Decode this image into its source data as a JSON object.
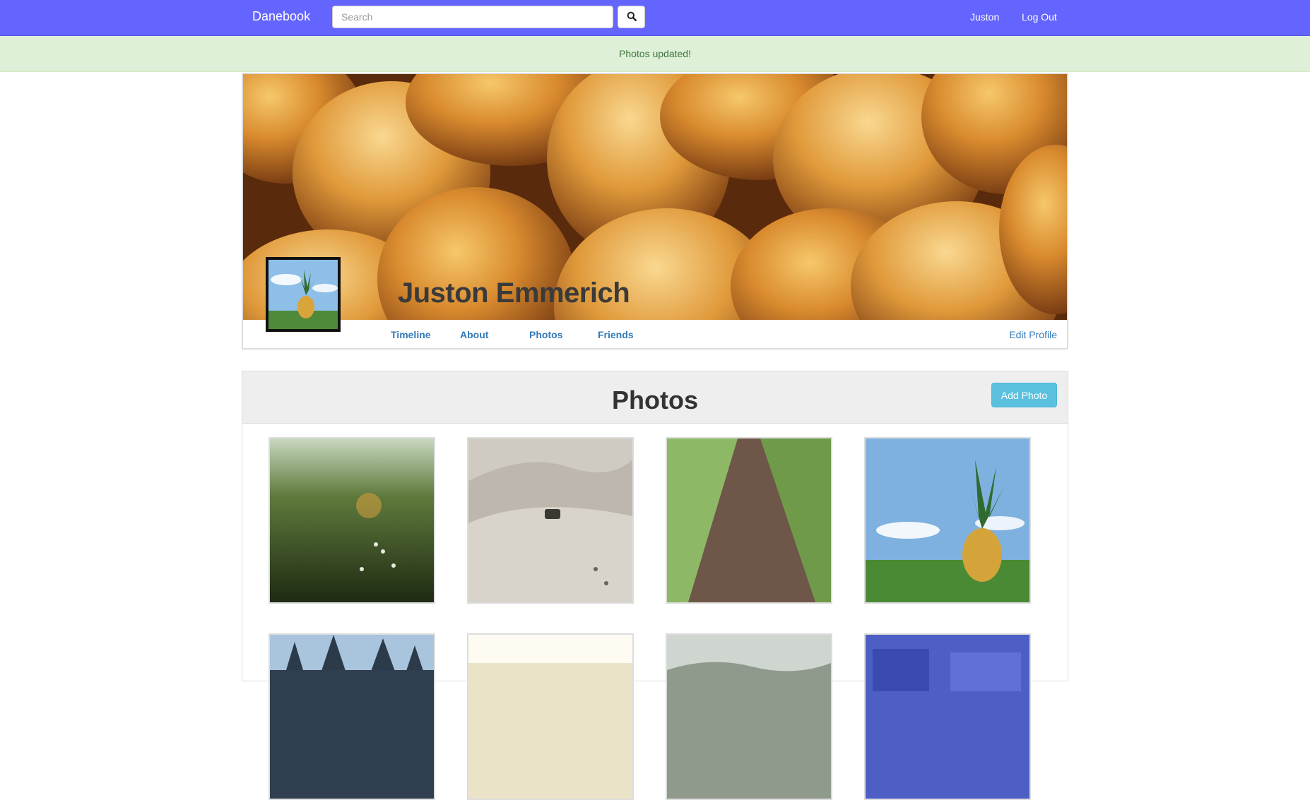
{
  "navbar": {
    "brand": "Danebook",
    "search_placeholder": "Search",
    "search_icon": "search-icon",
    "user_link": "Juston",
    "logout_link": "Log Out"
  },
  "alert": {
    "message": "Photos updated!"
  },
  "profile": {
    "name": "Juston Emmerich",
    "cover_image": "bread-rolls-photo",
    "avatar_image": "pineapple-photo",
    "nav": {
      "timeline": "Timeline",
      "about": "About",
      "photos": "Photos",
      "friends": "Friends",
      "edit_profile": "Edit Profile"
    }
  },
  "photos_section": {
    "title": "Photos",
    "add_button": "Add Photo",
    "photos": [
      {
        "subject": "wildflowers-meadow-photo"
      },
      {
        "subject": "desert-dunes-vehicle-photo"
      },
      {
        "subject": "forest-path-photo"
      },
      {
        "subject": "pineapple-in-grass-photo"
      },
      {
        "subject": "pine-trees-sky-photo"
      },
      {
        "subject": "bright-horizon-photo"
      },
      {
        "subject": "mountain-landscape-photo"
      },
      {
        "subject": "blue-abstract-photo"
      }
    ]
  },
  "colors": {
    "navbar": "#6464ff",
    "alert_bg": "#dff0d8",
    "alert_text": "#3c763d",
    "link": "#337ab7",
    "add_button": "#5bc0de"
  }
}
